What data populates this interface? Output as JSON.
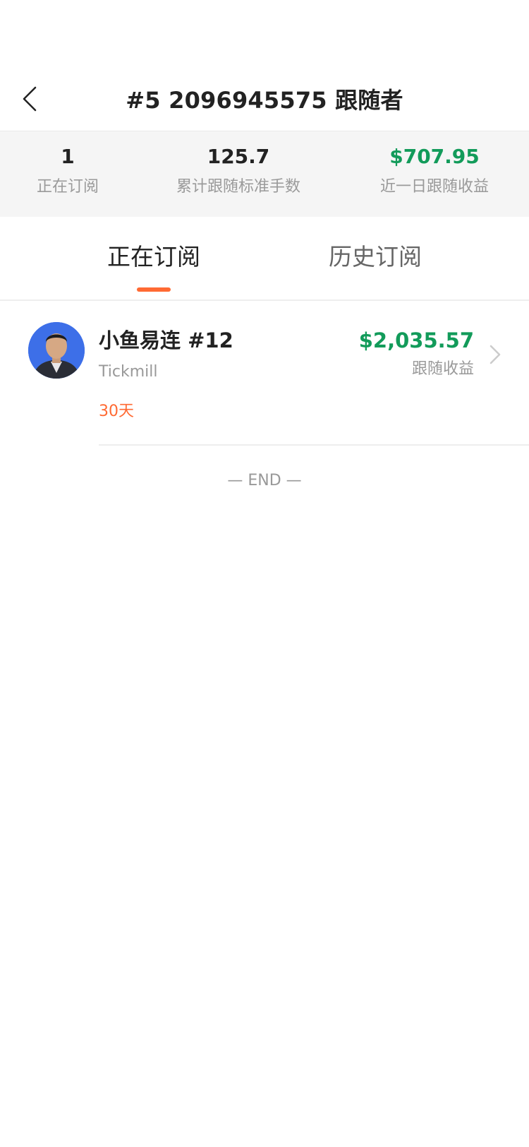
{
  "header": {
    "title": "#5 2096945575 跟随者",
    "back_icon": "chevron-left-icon"
  },
  "stats": [
    {
      "value": "1",
      "label": "正在订阅"
    },
    {
      "value": "125.7",
      "label": "累计跟随标准手数"
    },
    {
      "value": "$707.95",
      "label": "近一日跟随收益",
      "color": "#129b5a"
    }
  ],
  "tabs": [
    {
      "label": "正在订阅",
      "active": true
    },
    {
      "label": "历史订阅",
      "active": false
    }
  ],
  "subscriptions": [
    {
      "name": "小鱼易连 #12",
      "broker": "Tickmill",
      "duration": "30天",
      "profit": "$2,035.57",
      "profit_label": "跟随收益"
    }
  ],
  "end_marker": "— END —",
  "colors": {
    "accent": "#ff6a33",
    "profit": "#129b5a",
    "banner_bg": "#f5f5f5"
  }
}
